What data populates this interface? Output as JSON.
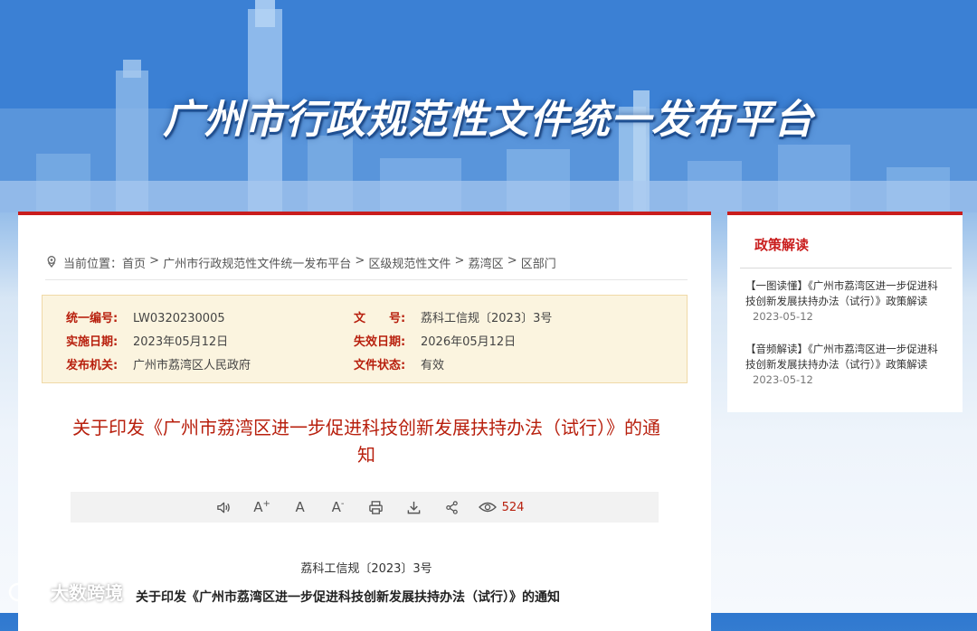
{
  "banner": {
    "title": "广州市行政规范性文件统一发布平台"
  },
  "breadcrumb": {
    "prefix": "当前位置：",
    "items": [
      "首页",
      "广州市行政规范性文件统一发布平台",
      "区级规范性文件",
      "荔湾区",
      "区部门"
    ],
    "separator": " > "
  },
  "meta": {
    "code_label": "统一编号:",
    "code_value": "LW0320230005",
    "doc_label": "文　　号:",
    "doc_value": "荔科工信规〔2023〕3号",
    "impl_label": "实施日期:",
    "impl_value": "2023年05月12日",
    "expire_label": "失效日期:",
    "expire_value": "2026年05月12日",
    "issuer_label": "发布机关:",
    "issuer_value": "广州市荔湾区人民政府",
    "status_label": "文件状态:",
    "status_value": "有效"
  },
  "document": {
    "title": "关于印发《广州市荔湾区进一步促进科技创新发展扶持办法（试行）》的通知",
    "number": "荔科工信规〔2023〕3号",
    "subtitle": "关于印发《广州市荔湾区进一步促进科技创新发展扶持办法（试行）》的通知"
  },
  "toolbar": {
    "font_large": "A",
    "font_normal": "A",
    "font_small": "A",
    "plus": "+",
    "minus": "-",
    "view_count": "524"
  },
  "sidebar": {
    "title": "政策解读",
    "items": [
      {
        "text": "【一图读懂】《广州市荔湾区进一步促进科技创新发展扶持办法（试行）》政策解读",
        "date": "2023-05-12"
      },
      {
        "text": "【音频解读】《广州市荔湾区进一步促进科技创新发展扶持办法（试行）》政策解读",
        "date": "2023-05-12"
      }
    ]
  },
  "watermark": {
    "text": "大数跨境"
  },
  "colors": {
    "accent": "#c91d1d",
    "title_red": "#b8200e",
    "meta_bg": "#fbf4df"
  }
}
